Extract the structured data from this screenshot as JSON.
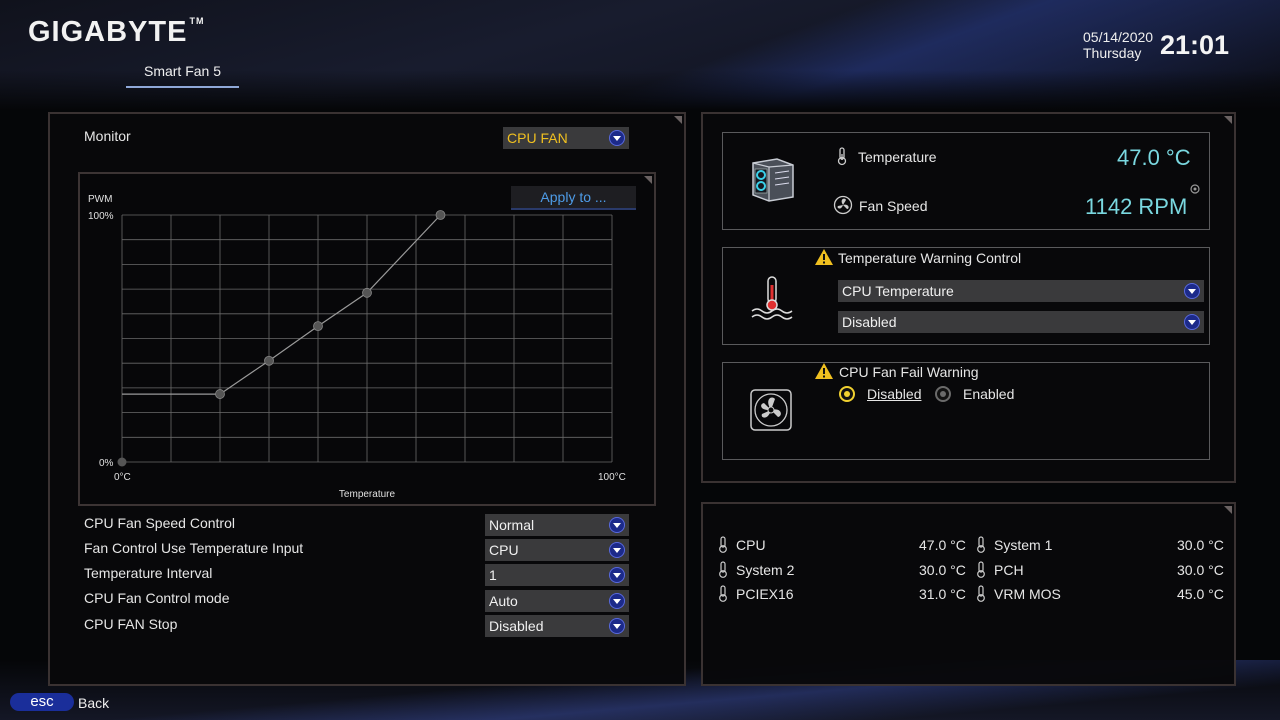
{
  "brand": {
    "logo": "GIGABYTE",
    "tm": "TM"
  },
  "page_tab": "Smart Fan 5",
  "datetime": {
    "date": "05/14/2020",
    "day": "Thursday",
    "time": "21:01"
  },
  "left": {
    "monitor_label": "Monitor",
    "monitor_select": "CPU FAN",
    "apply_button": "Apply to ...",
    "settings": [
      {
        "label": "CPU Fan Speed Control",
        "value": "Normal"
      },
      {
        "label": "Fan Control Use Temperature Input",
        "value": "CPU"
      },
      {
        "label": "Temperature Interval",
        "value": "1"
      },
      {
        "label": "CPU Fan Control mode",
        "value": "Auto"
      },
      {
        "label": "CPU FAN Stop",
        "value": "Disabled"
      }
    ]
  },
  "chart_data": {
    "type": "line",
    "ylabel": "PWM",
    "xlabel": "Temperature",
    "x_tick_labels": [
      "0°C",
      "100°C"
    ],
    "y_tick_labels": [
      "0%",
      "100%"
    ],
    "xlim": [
      0,
      100
    ],
    "ylim": [
      0,
      100
    ],
    "grid": true,
    "series": [
      {
        "x": [
          0,
          20,
          30,
          40,
          50,
          65
        ],
        "y": [
          27.5,
          27.5,
          41,
          55,
          68.5,
          100
        ]
      }
    ],
    "origin_point": {
      "x": 0,
      "y": 0
    }
  },
  "status": {
    "temperature_label": "Temperature",
    "temperature_value": "47.0 °C",
    "fan_speed_label": "Fan Speed",
    "fan_speed_value": "1142 RPM"
  },
  "temp_warning": {
    "title": "Temperature Warning Control",
    "source_select": "CPU Temperature",
    "level_select": "Disabled"
  },
  "fan_fail": {
    "title": "CPU Fan Fail Warning",
    "options": [
      "Disabled",
      "Enabled"
    ],
    "selected": "Disabled"
  },
  "sensors": [
    {
      "name": "CPU",
      "value": "47.0 °C"
    },
    {
      "name": "System 1",
      "value": "30.0 °C"
    },
    {
      "name": "System 2",
      "value": "30.0 °C"
    },
    {
      "name": "PCH",
      "value": "30.0 °C"
    },
    {
      "name": "PCIEX16",
      "value": "31.0 °C"
    },
    {
      "name": "VRM MOS",
      "value": "45.0 °C"
    }
  ],
  "footer": {
    "esc_key": "esc",
    "esc_label": "Back"
  },
  "colors": {
    "accent_yellow": "#f0d030",
    "accent_cyan": "#7ad8e0",
    "link_blue": "#4e9ce8",
    "dropdown_blue": "#1c2a8a"
  }
}
